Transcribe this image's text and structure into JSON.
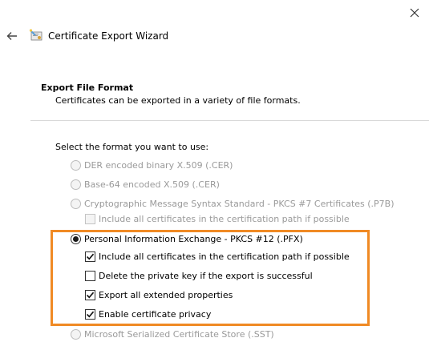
{
  "window": {
    "title": "Certificate Export Wizard",
    "close_glyph": "✕",
    "back_glyph": "←"
  },
  "header": {
    "title": "Export File Format",
    "description": "Certificates can be exported in a variety of file formats."
  },
  "prompt": "Select the format you want to use:",
  "options": {
    "der": {
      "label": "DER encoded binary X.509 (.CER)",
      "selected": false,
      "enabled": false
    },
    "base64": {
      "label": "Base-64 encoded X.509 (.CER)",
      "selected": false,
      "enabled": false
    },
    "pkcs7": {
      "label": "Cryptographic Message Syntax Standard - PKCS #7 Certificates (.P7B)",
      "selected": false,
      "enabled": false
    },
    "pkcs7_include_all": {
      "label": "Include all certificates in the certification path if possible",
      "checked": false,
      "enabled": false
    },
    "pfx": {
      "label": "Personal Information Exchange - PKCS #12 (.PFX)",
      "selected": true,
      "enabled": true
    },
    "pfx_include_all": {
      "label": "Include all certificates in the certification path if possible",
      "checked": true,
      "enabled": true
    },
    "pfx_delete_key": {
      "label": "Delete the private key if the export is successful",
      "checked": false,
      "enabled": true
    },
    "pfx_export_props": {
      "label": "Export all extended properties",
      "checked": true,
      "enabled": true
    },
    "pfx_privacy": {
      "label": "Enable certificate privacy",
      "checked": true,
      "enabled": true
    },
    "sst": {
      "label": "Microsoft Serialized Certificate Store (.SST)",
      "selected": false,
      "enabled": false
    }
  },
  "colors": {
    "highlight": "#f08a24",
    "disabled_text": "#9a9a9a"
  },
  "icons": {
    "close": "close-icon",
    "back": "back-arrow-icon",
    "wizard": "certificate-wizard-icon",
    "check": "checkmark-icon"
  }
}
